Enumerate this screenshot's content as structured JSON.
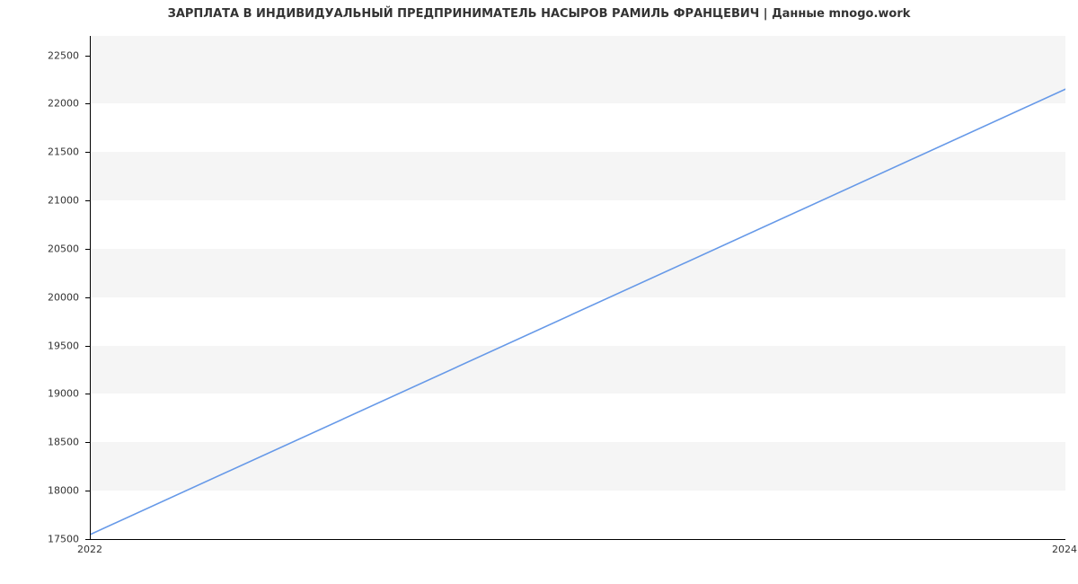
{
  "chart_data": {
    "type": "line",
    "title": "ЗАРПЛАТА В ИНДИВИДУАЛЬНЫЙ ПРЕДПРИНИМАТЕЛЬ НАСЫРОВ РАМИЛЬ ФРАНЦЕВИЧ | Данные mnogo.work",
    "xlabel": "",
    "ylabel": "",
    "x": [
      2022,
      2024
    ],
    "values": [
      17550,
      22150
    ],
    "y_ticks": [
      17500,
      18000,
      18500,
      19000,
      19500,
      20000,
      20500,
      21000,
      21500,
      22000,
      22500
    ],
    "x_ticks": [
      2022,
      2024
    ],
    "ylim": [
      17500,
      22700
    ],
    "xlim": [
      2022,
      2024
    ],
    "line_color": "#6699e8",
    "grid": true
  }
}
